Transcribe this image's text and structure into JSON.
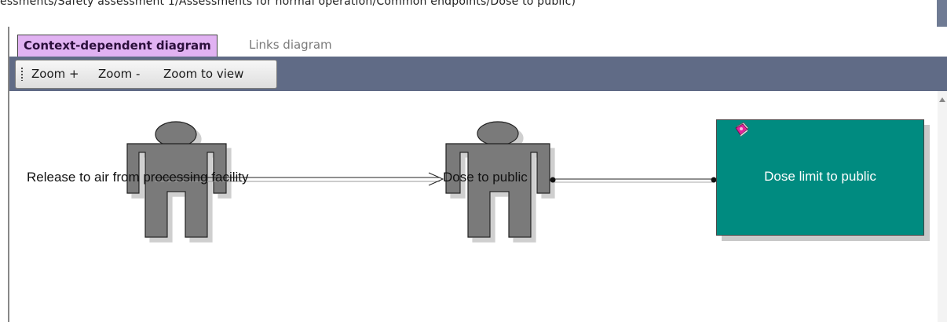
{
  "breadcrumb": {
    "path": "essments/Safety assessment 1/Assessments for normal operation/Common endpoints/Dose to public)"
  },
  "tabs": [
    {
      "label": "Context-dependent diagram",
      "active": true
    },
    {
      "label": "Links diagram",
      "active": false
    }
  ],
  "toolbar": {
    "zoom_in_label": "Zoom +",
    "zoom_out_label": "Zoom -",
    "zoom_to_view_label": "Zoom to view"
  },
  "diagram": {
    "source_node": {
      "label": "Release to air from processing facility",
      "icon": "person-icon"
    },
    "center_node": {
      "label": "Dose to public",
      "icon": "person-icon"
    },
    "target_node": {
      "label": "Dose limit to public",
      "icon": "book-icon"
    }
  },
  "colors": {
    "active_tab": "#e1b2f2",
    "toolbar_bg": "#606b86",
    "target_box": "#008b80",
    "person_fill": "#7a7a7a"
  }
}
